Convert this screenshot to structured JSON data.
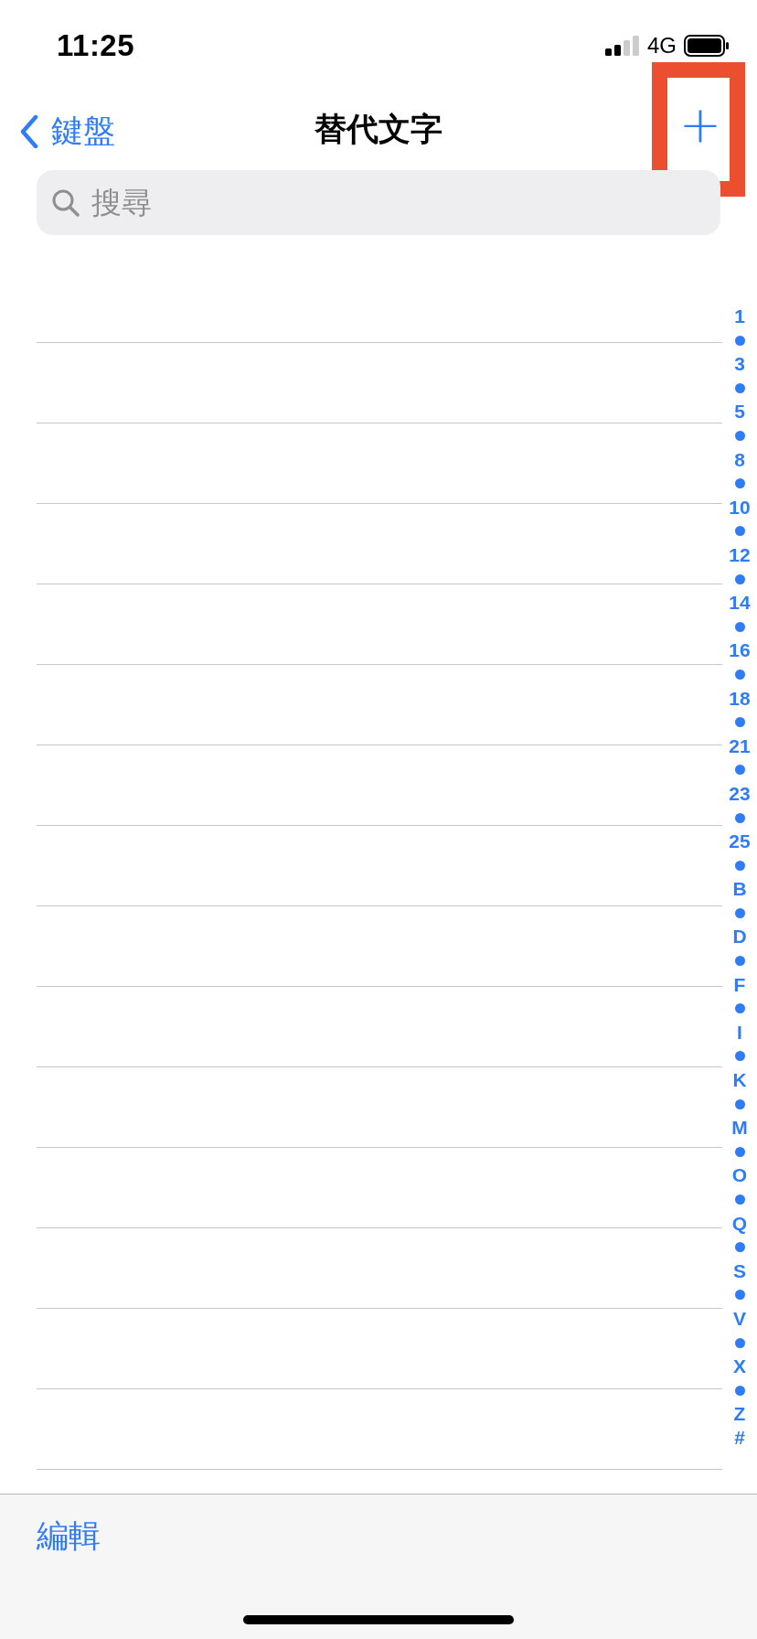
{
  "status_bar": {
    "time": "11:25",
    "network": "4G"
  },
  "nav_bar": {
    "back_label": "鍵盤",
    "title": "替代文字",
    "add_button": "+",
    "highlighted": true
  },
  "search": {
    "placeholder": "搜尋"
  },
  "section_index": [
    {
      "kind": "label",
      "text": "1"
    },
    {
      "kind": "dot"
    },
    {
      "kind": "label",
      "text": "3"
    },
    {
      "kind": "dot"
    },
    {
      "kind": "label",
      "text": "5"
    },
    {
      "kind": "dot"
    },
    {
      "kind": "label",
      "text": "8"
    },
    {
      "kind": "dot"
    },
    {
      "kind": "label",
      "text": "10"
    },
    {
      "kind": "dot"
    },
    {
      "kind": "label",
      "text": "12"
    },
    {
      "kind": "dot"
    },
    {
      "kind": "label",
      "text": "14"
    },
    {
      "kind": "dot"
    },
    {
      "kind": "label",
      "text": "16"
    },
    {
      "kind": "dot"
    },
    {
      "kind": "label",
      "text": "18"
    },
    {
      "kind": "dot"
    },
    {
      "kind": "label",
      "text": "21"
    },
    {
      "kind": "dot"
    },
    {
      "kind": "label",
      "text": "23"
    },
    {
      "kind": "dot"
    },
    {
      "kind": "label",
      "text": "25"
    },
    {
      "kind": "dot"
    },
    {
      "kind": "label",
      "text": "B"
    },
    {
      "kind": "dot"
    },
    {
      "kind": "label",
      "text": "D"
    },
    {
      "kind": "dot"
    },
    {
      "kind": "label",
      "text": "F"
    },
    {
      "kind": "dot"
    },
    {
      "kind": "label",
      "text": "I"
    },
    {
      "kind": "dot"
    },
    {
      "kind": "label",
      "text": "K"
    },
    {
      "kind": "dot"
    },
    {
      "kind": "label",
      "text": "M"
    },
    {
      "kind": "dot"
    },
    {
      "kind": "label",
      "text": "O"
    },
    {
      "kind": "dot"
    },
    {
      "kind": "label",
      "text": "Q"
    },
    {
      "kind": "dot"
    },
    {
      "kind": "label",
      "text": "S"
    },
    {
      "kind": "dot"
    },
    {
      "kind": "label",
      "text": "V"
    },
    {
      "kind": "dot"
    },
    {
      "kind": "label",
      "text": "X"
    },
    {
      "kind": "dot"
    },
    {
      "kind": "label",
      "text": "Z"
    },
    {
      "kind": "label",
      "text": "#"
    }
  ],
  "toolbar": {
    "edit_button": "編輯"
  }
}
